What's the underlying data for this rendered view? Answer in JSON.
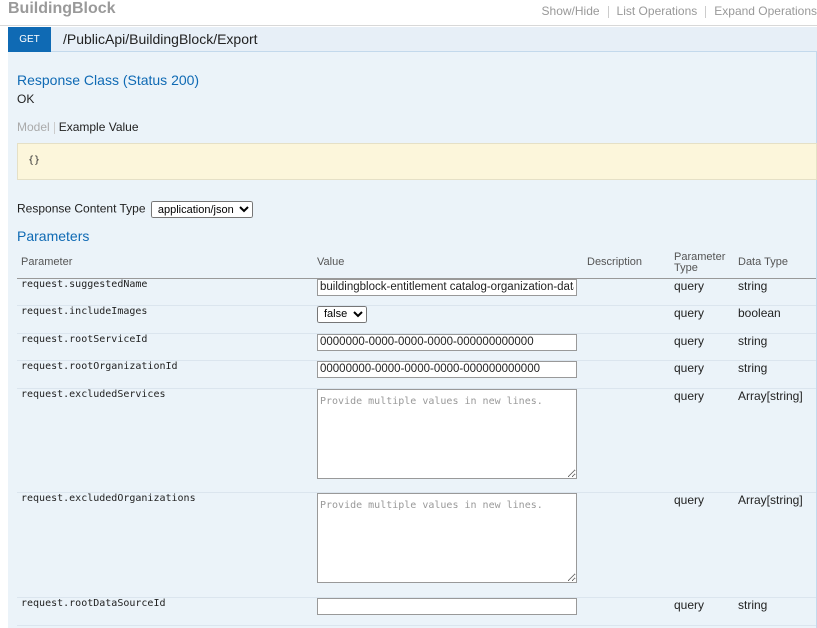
{
  "header": {
    "title": "BuildingBlock",
    "links": [
      "Show/Hide",
      "List Operations",
      "Expand Operations"
    ]
  },
  "operation": {
    "method": "GET",
    "path": "/PublicApi/BuildingBlock/Export"
  },
  "response": {
    "class_title": "Response Class (Status 200)",
    "status_text": "OK",
    "tab_model": "Model",
    "tab_example": "Example Value",
    "example_code": "{}"
  },
  "content_type": {
    "label": "Response Content Type",
    "selected": "application/json"
  },
  "parameters": {
    "title": "Parameters",
    "columns": {
      "parameter": "Parameter",
      "value": "Value",
      "description": "Description",
      "param_type": "Parameter Type",
      "data_type": "Data Type"
    },
    "rows": [
      {
        "name": "request.suggestedName",
        "value": "buildingblock-entitlement catalog-organization-data",
        "param_type": "query",
        "data_type": "string"
      },
      {
        "name": "request.includeImages",
        "value": "false",
        "param_type": "query",
        "data_type": "boolean"
      },
      {
        "name": "request.rootServiceId",
        "value": "0000000-0000-0000-0000-000000000000",
        "param_type": "query",
        "data_type": "string"
      },
      {
        "name": "request.rootOrganizationId",
        "value": "00000000-0000-0000-0000-000000000000",
        "param_type": "query",
        "data_type": "string"
      },
      {
        "name": "request.excludedServices",
        "placeholder": "Provide multiple values in new lines.",
        "param_type": "query",
        "data_type": "Array[string]"
      },
      {
        "name": "request.excludedOrganizations",
        "placeholder": "Provide multiple values in new lines.",
        "param_type": "query",
        "data_type": "Array[string]"
      },
      {
        "name": "request.rootDataSourceId",
        "value": "",
        "param_type": "query",
        "data_type": "string"
      }
    ]
  }
}
